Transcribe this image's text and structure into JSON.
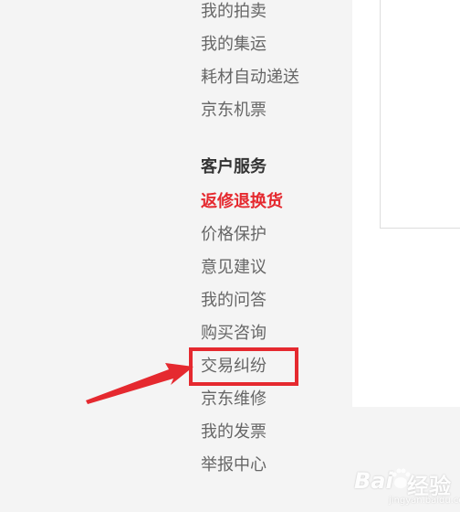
{
  "colors": {
    "accent_red": "#e5292f",
    "nav_text": "#666666",
    "heading_text": "#333333",
    "sidebar_bg": "#f4f4f4",
    "main_bg": "#ffffff"
  },
  "sidebar": {
    "items_top": [
      {
        "label": "我的拍卖"
      },
      {
        "label": "我的集运"
      },
      {
        "label": "耗材自动递送"
      },
      {
        "label": "京东机票"
      }
    ],
    "section": {
      "heading": "客户服务",
      "items": [
        {
          "label": "返修退换货",
          "active": true
        },
        {
          "label": "价格保护"
        },
        {
          "label": "意见建议"
        },
        {
          "label": "我的问答"
        },
        {
          "label": "购买咨询"
        },
        {
          "label": "交易纠纷",
          "highlighted": true
        },
        {
          "label": "京东维修"
        },
        {
          "label": "我的发票"
        },
        {
          "label": "举报中心"
        }
      ]
    }
  },
  "watermark": {
    "brand": "Bai",
    "suffix": "经验",
    "url": "jingyan.baidu.com"
  }
}
